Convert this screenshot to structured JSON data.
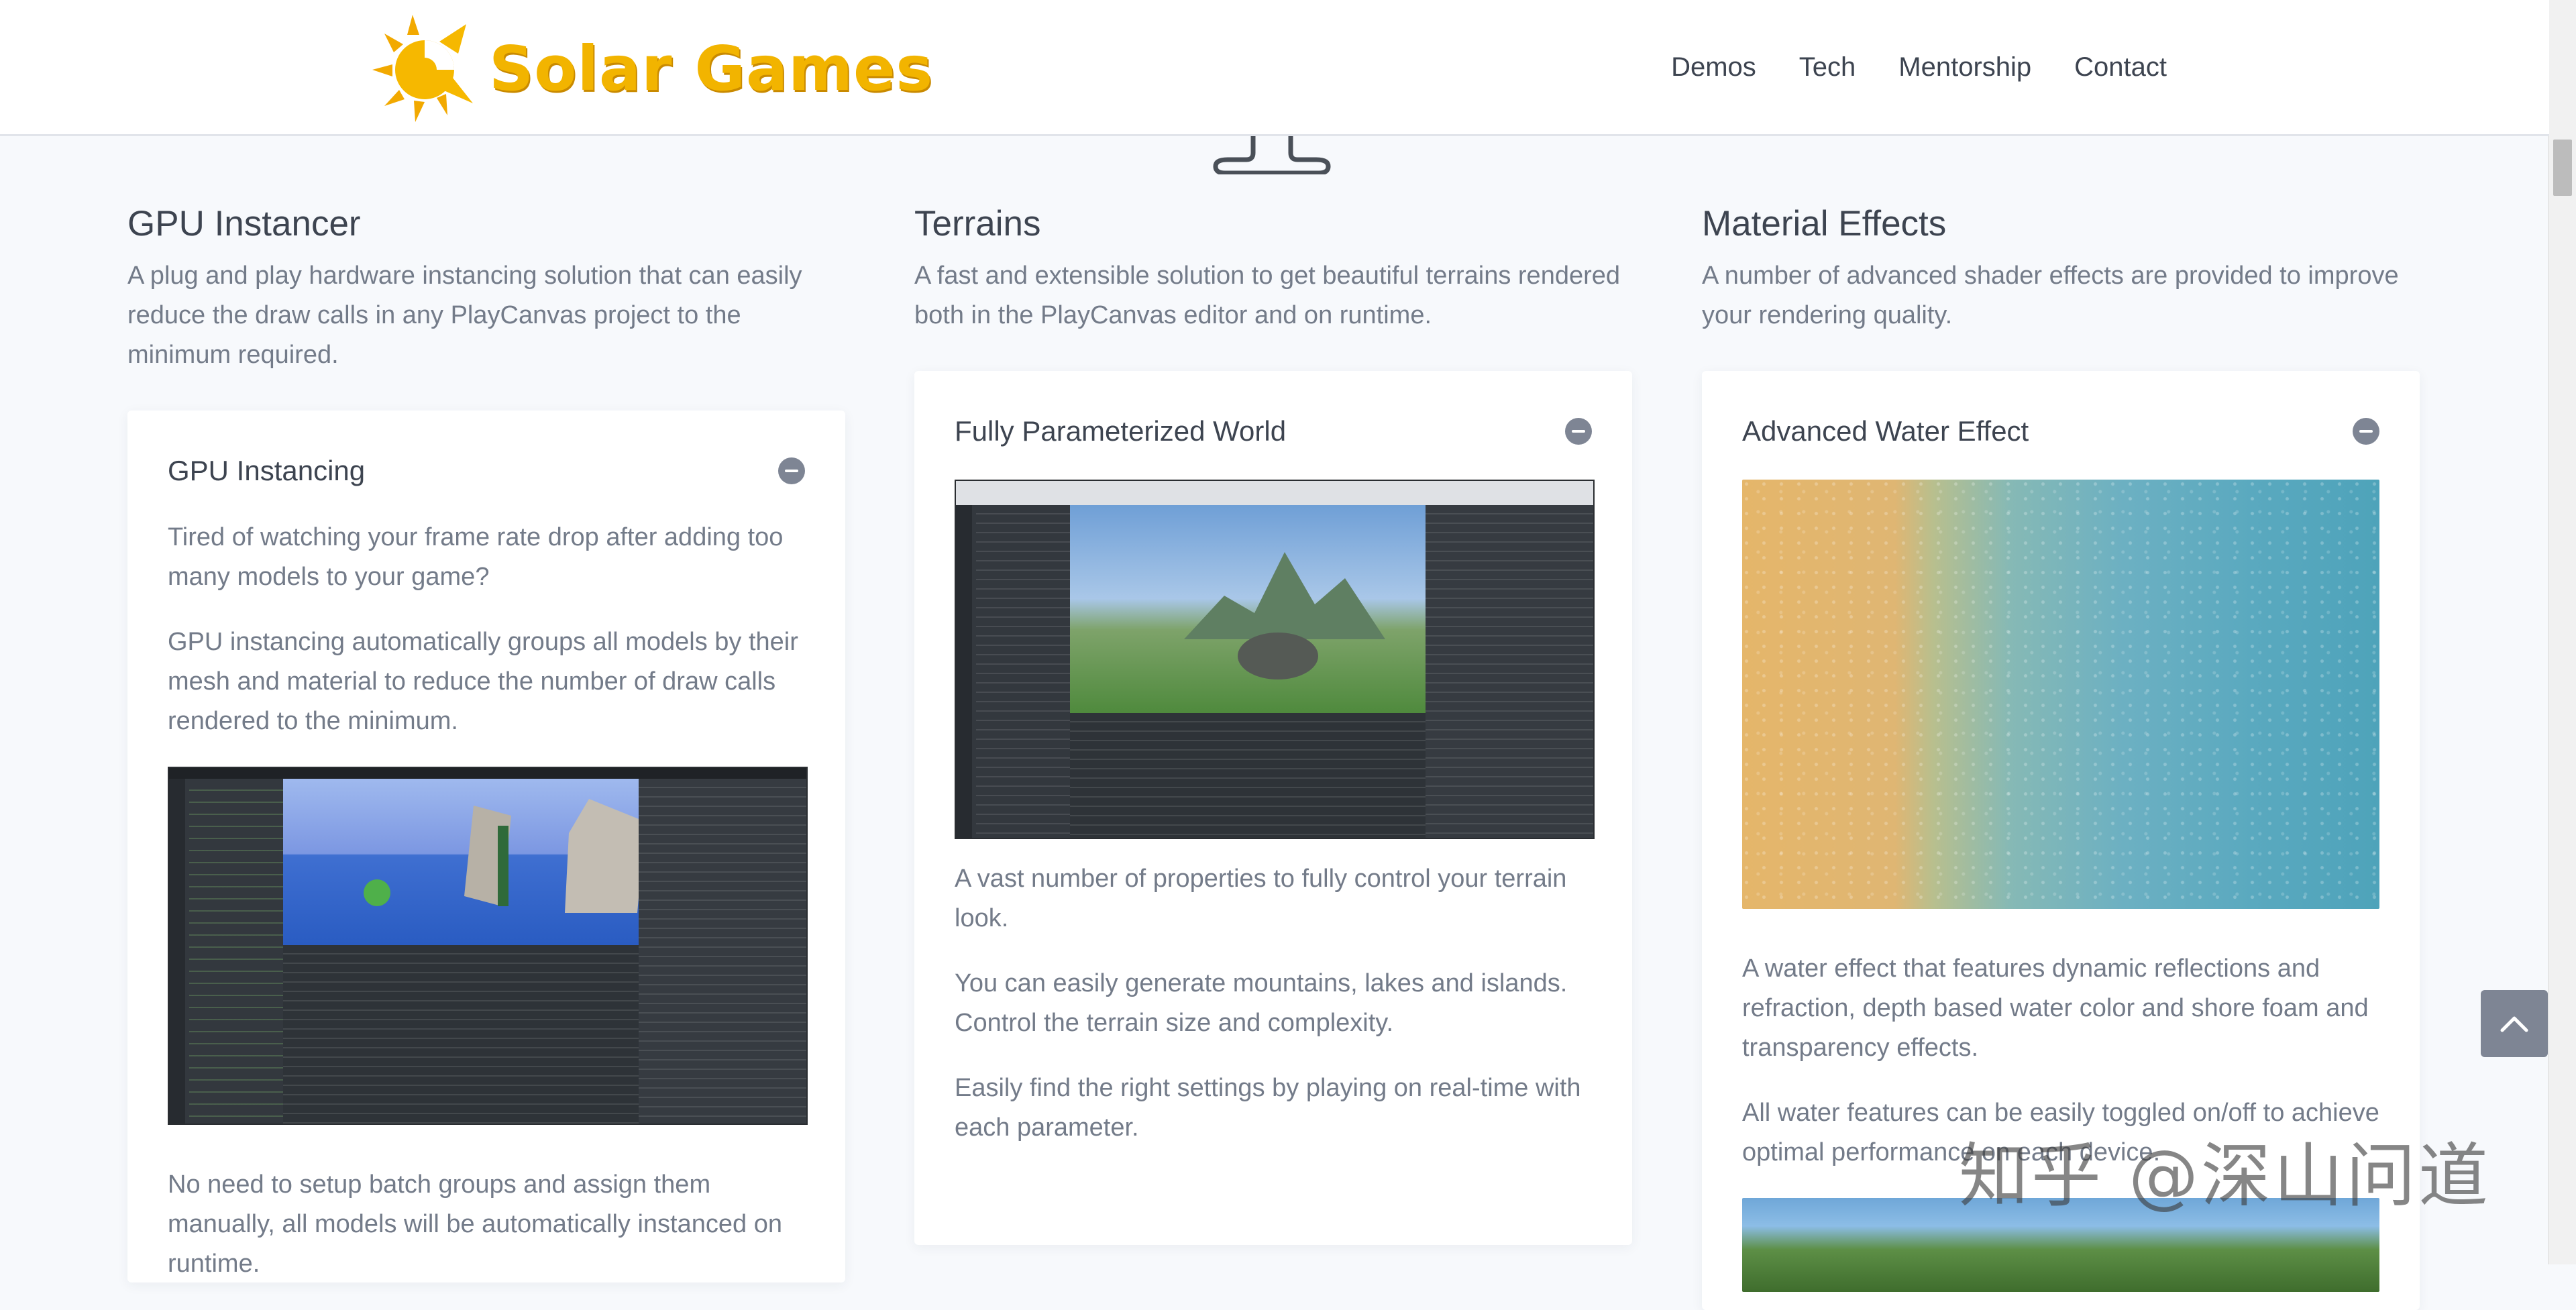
{
  "brand": {
    "name": "Solar Games"
  },
  "nav": {
    "items": [
      "Demos",
      "Tech",
      "Mentorship",
      "Contact"
    ]
  },
  "sections": [
    {
      "title": "GPU Instancer",
      "description": "A plug and play hardware instancing solution that can easily reduce the draw calls in any PlayCanvas project to the minimum required.",
      "card": {
        "title": "GPU Instancing",
        "paragraphs": [
          "Tired of watching your frame rate drop after adding too many models to your game?",
          "GPU instancing automatically groups all models by their mesh and material to reduce the number of draw calls rendered to the minimum.",
          "No need to setup batch groups and assign them manually, all models will be automatically instanced on runtime."
        ]
      }
    },
    {
      "title": "Terrains",
      "description": "A fast and extensible solution to get beautiful terrains rendered both in the PlayCanvas editor and on runtime.",
      "card": {
        "title": "Fully Parameterized World",
        "paragraphs": [
          "A vast number of properties to fully control your terrain look.",
          "You can easily generate mountains, lakes and islands. Control the terrain size and complexity.",
          "Easily find the right settings by playing on real-time with each parameter."
        ]
      }
    },
    {
      "title": "Material Effects",
      "description": "A number of advanced shader effects are provided to improve your rendering quality.",
      "card": {
        "title": "Advanced Water Effect",
        "paragraphs": [
          "A water effect that features dynamic reflections and refraction, depth based water color and shore foam and transparency effects.",
          "All water features can be easily toggled on/off to achieve optimal performance on each device."
        ]
      }
    }
  ],
  "watermark": "知乎 @深山问道",
  "colors": {
    "accent": "#f2b400",
    "text_dark": "#3d4450",
    "text_muted": "#737b89",
    "button_gray": "#7e8594"
  }
}
